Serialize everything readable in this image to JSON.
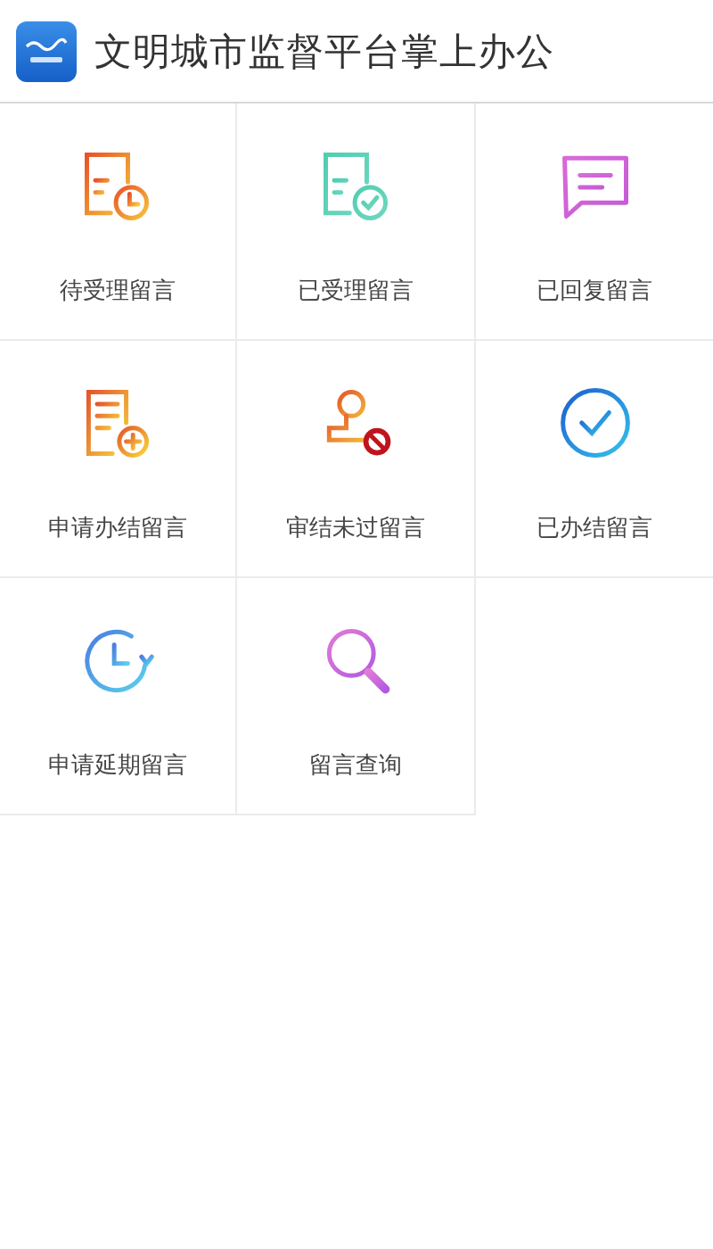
{
  "header": {
    "title": "文明城市监督平台掌上办公"
  },
  "menu": [
    {
      "label": "待受理留言",
      "kind": "pending"
    },
    {
      "label": "已受理留言",
      "kind": "accepted"
    },
    {
      "label": "已回复留言",
      "kind": "replied"
    },
    {
      "label": "申请办结留言",
      "kind": "apply-close"
    },
    {
      "label": "审结未过留言",
      "kind": "rejected"
    },
    {
      "label": "已办结留言",
      "kind": "closed"
    },
    {
      "label": "申请延期留言",
      "kind": "extend"
    },
    {
      "label": "留言查询",
      "kind": "search"
    }
  ]
}
